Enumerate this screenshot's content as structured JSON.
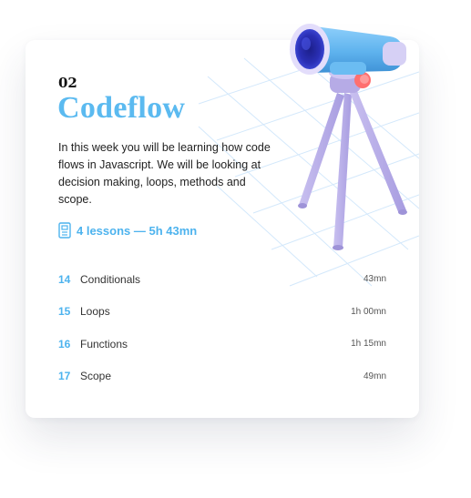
{
  "course": {
    "week_number": "02",
    "title": "Codeflow",
    "description": "In this week you will be learning how code flows in Javascript. We will be looking at decision making, loops, methods and scope.",
    "lessons_summary": "4 lessons — 5h 43mn"
  },
  "lessons": [
    {
      "number": "14",
      "name": "Conditionals",
      "duration": "43mn"
    },
    {
      "number": "15",
      "name": "Loops",
      "duration": "1h 00mn"
    },
    {
      "number": "16",
      "name": "Functions",
      "duration": "1h 15mn"
    },
    {
      "number": "17",
      "name": "Scope",
      "duration": "49mn"
    }
  ],
  "icons": {
    "lessons_meta": "document-icon",
    "illustration": "telescope-illustration"
  },
  "colors": {
    "accent": "#5bbaf0",
    "text": "#1f1f1f",
    "telescope_body": "#5fb3ee",
    "telescope_stand": "#b9aee8"
  }
}
